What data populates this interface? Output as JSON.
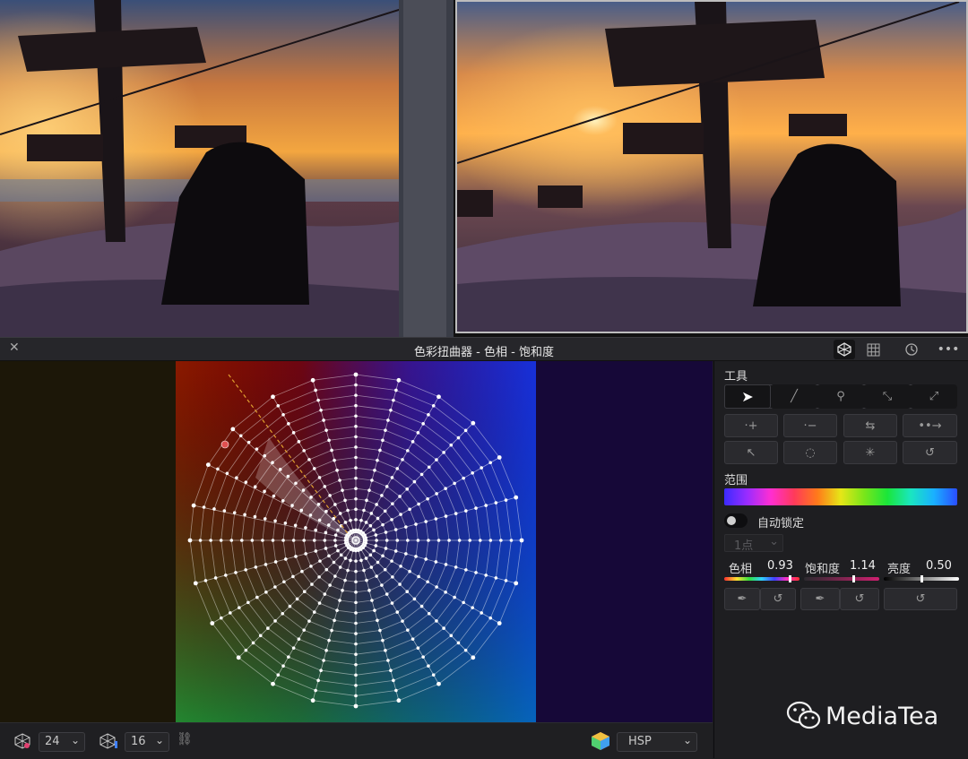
{
  "window": {
    "title": "色彩扭曲器 - 色相 - 饱和度"
  },
  "header_icons": [
    "warper-icon",
    "grid-icon",
    "history-icon",
    "more-icon"
  ],
  "bottom": {
    "columns_value": "24",
    "rows_value": "16",
    "colorspace_value": "HSP"
  },
  "panel": {
    "tools_label": "工具",
    "range_label": "范围",
    "auto_lock_label": "自动锁定",
    "points_value": "1点",
    "hue": {
      "label": "色相",
      "value": "0.93"
    },
    "saturation": {
      "label": "饱和度",
      "value": "1.14"
    },
    "luminance": {
      "label": "亮度",
      "value": "0.50"
    }
  },
  "watermark": {
    "text": "MediaTea"
  },
  "colors": {
    "accent_red": "#e05050",
    "guide_line": "#e0a030",
    "mesh": "#ffffff"
  }
}
